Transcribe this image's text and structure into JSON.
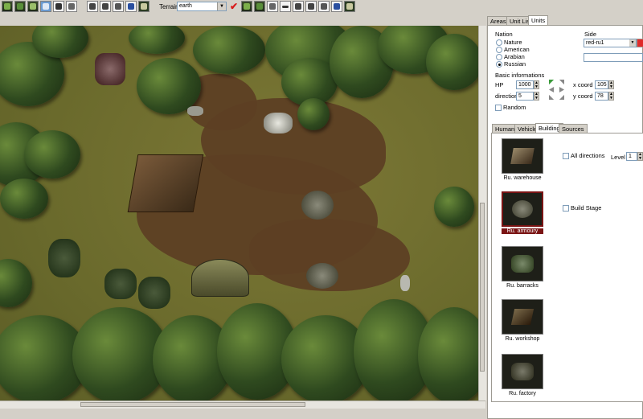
{
  "toolbar": {
    "terrain_label": "Terrain",
    "terrain_value": "earth",
    "terrain_options_visible": [
      "earth"
    ],
    "tools_left": [
      "forest-tool-icon",
      "tree-tool-icon",
      "area-tool-icon",
      "select-tool-icon",
      "human-tool-icon",
      "brush-tool-icon"
    ],
    "tools_mid": [
      "units-tool-icon",
      "people-tool-icon",
      "vehicle-tool-icon",
      "ape-tool-icon",
      "building-tool-icon"
    ],
    "tools_right": [
      "forest2-tool-icon",
      "tree2-tool-icon",
      "brush2-tool-icon",
      "erase-tool-icon",
      "units2-tool-icon",
      "people2-tool-icon",
      "vehicle2-tool-icon",
      "ape2-tool-icon",
      "building2-tool-icon"
    ],
    "confirm_icon": "checkmark-icon",
    "colors": {
      "confirm": "#d81b1b"
    }
  },
  "panel": {
    "top_tabs": [
      "Areas",
      "Unit List",
      "Units"
    ],
    "top_tab_active": "Units",
    "nation": {
      "label": "Nation",
      "options": [
        "Nature",
        "American",
        "Arabian",
        "Russian"
      ],
      "selected": "Russian"
    },
    "side": {
      "label": "Side",
      "value": "red-ru1",
      "color": "#e02a2a",
      "extra_value": ""
    },
    "basic": {
      "label": "Basic informations",
      "hp_label": "HP",
      "hp_value": "1000",
      "direction_label": "direction",
      "direction_value": "5",
      "x_label": "x coord",
      "x_value": "105",
      "y_label": "y coord",
      "y_value": "78",
      "random_label": "Random"
    },
    "sub_tabs": [
      "Human",
      "Vehicle",
      "Building",
      "Sources"
    ],
    "sub_tab_active": "Building",
    "buildings": [
      {
        "name": "Ru. warehouse",
        "selected": false
      },
      {
        "name": "Ru. armoury",
        "selected": true
      },
      {
        "name": "Ru. barracks",
        "selected": false
      },
      {
        "name": "Ru. workshop",
        "selected": false
      },
      {
        "name": "Ru. factory",
        "selected": false
      }
    ],
    "all_directions_label": "All directions",
    "level_label": "Level",
    "level_value": "1",
    "build_stage_label": "Build Stage"
  }
}
